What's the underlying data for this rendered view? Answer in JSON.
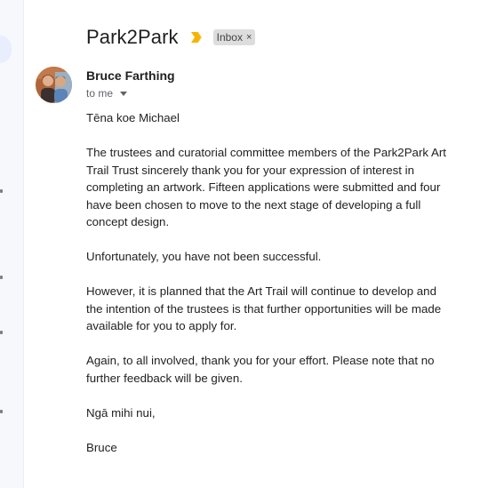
{
  "email": {
    "subject": "Park2Park",
    "label": "Inbox",
    "label_close": "×",
    "sender": "Bruce Farthing",
    "recipient": "to me",
    "body": [
      "Tēna koe Michael",
      "The trustees and curatorial committee members of the Park2Park Art Trail Trust sincerely thank you for your expression of interest in completing an artwork. Fifteen applications were submitted and four have been chosen to move to the next stage of developing a full concept design.",
      "Unfortunately, you have not been successful.",
      "However, it is planned that the Art Trail will continue to develop and the intention of the trustees is that further opportunities will be made available for you to apply for.",
      "Again, to all involved, thank you for your effort. Please note that no further feedback will be given.",
      "Ngā mihi nui,",
      "Bruce"
    ]
  },
  "icons": {
    "importance": "importance-marker-icon",
    "avatar": "sender-avatar-photo",
    "caret": "chevron-down-icon"
  },
  "colors": {
    "importance": "#f4b400",
    "label_bg": "#dddddd",
    "rail_bg": "#f6f8fc",
    "rail_active": "#e8eefc"
  }
}
